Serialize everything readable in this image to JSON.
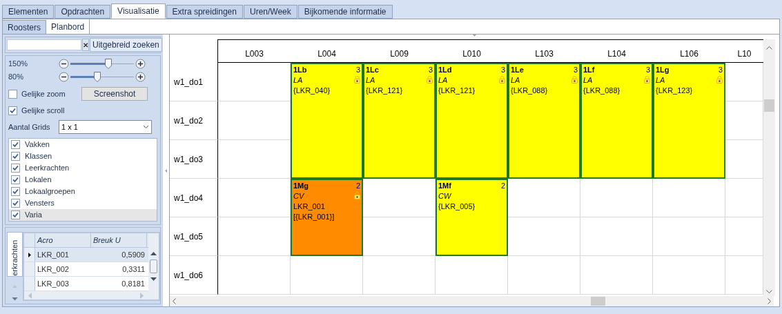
{
  "tabs": [
    {
      "label": "Elementen",
      "selected": false
    },
    {
      "label": "Opdrachten",
      "selected": false
    },
    {
      "label": "Visualisatie",
      "selected": true
    },
    {
      "label": "Extra spreidingen",
      "selected": false
    },
    {
      "label": "Uren/Week",
      "selected": false
    },
    {
      "label": "Bijkomende informatie",
      "selected": false
    }
  ],
  "subtabs": [
    {
      "label": "Roosters",
      "selected": false
    },
    {
      "label": "Planbord",
      "selected": true
    }
  ],
  "sidebar": {
    "clear_button": "✕",
    "advanced_search_button": "Uitgebreid zoeken",
    "zoom_sliders": [
      {
        "reading": "150%",
        "level": 0.6
      },
      {
        "reading": "80%",
        "level": 0.42
      }
    ],
    "equal_zoom": {
      "label": "Gelijke zoom",
      "checked": false
    },
    "screenshot_button": "Screenshot",
    "equal_scroll": {
      "label": "Gelijke scroll",
      "checked": true
    },
    "grid_count": {
      "label": "Aantal Grids",
      "value": "1 x 1"
    },
    "layers": [
      {
        "label": "Vakken",
        "checked": true,
        "selected": false
      },
      {
        "label": "Klassen",
        "checked": true,
        "selected": false
      },
      {
        "label": "Leerkrachten",
        "checked": true,
        "selected": false
      },
      {
        "label": "Lokalen",
        "checked": true,
        "selected": false
      },
      {
        "label": "Lokaalgroepen",
        "checked": true,
        "selected": false
      },
      {
        "label": "Vensters",
        "checked": true,
        "selected": false
      },
      {
        "label": "Varia",
        "checked": true,
        "selected": true
      }
    ],
    "side_tab": "erkrachten",
    "table": {
      "columns": [
        "Acro",
        "Breuk U"
      ],
      "rows": [
        {
          "cells": [
            "LKR_001",
            "0,5909"
          ],
          "selected": true
        },
        {
          "cells": [
            "LKR_002",
            "0,3311"
          ],
          "selected": false
        },
        {
          "cells": [
            "LKR_003",
            "0,8181"
          ],
          "selected": false
        }
      ]
    }
  },
  "planboard": {
    "columns": [
      "L003",
      "L004",
      "L009",
      "L010",
      "L103",
      "L104",
      "L106",
      "L10"
    ],
    "rows": [
      {
        "label": "w1_do1",
        "cells": [
          {
            "kind": "empty"
          },
          {
            "kind": "lesson",
            "code": "1Lb",
            "count": "3",
            "lines": [
              "LA",
              "{LKR_040}"
            ],
            "color": "#ffff00",
            "locked": true
          },
          {
            "kind": "lesson",
            "code": "1Lc",
            "count": "3",
            "lines": [
              "LA",
              "{LKR_121}"
            ],
            "color": "#ffff00",
            "locked": true
          },
          {
            "kind": "lesson",
            "code": "1Ld",
            "count": "3",
            "lines": [
              "LA",
              "{LKR_121}"
            ],
            "color": "#ffff00",
            "locked": true
          },
          {
            "kind": "lesson",
            "code": "1Le",
            "count": "3",
            "lines": [
              "LA",
              "{LKR_088}"
            ],
            "color": "#ffff00",
            "locked": true
          },
          {
            "kind": "lesson",
            "code": "1Lf",
            "count": "3",
            "lines": [
              "LA",
              "{LKR_088}"
            ],
            "color": "#ffff00",
            "locked": true
          },
          {
            "kind": "lesson",
            "code": "1Lg",
            "count": "3",
            "lines": [
              "LA",
              "{LKR_123}"
            ],
            "color": "#ffff00",
            "locked": true
          },
          {
            "kind": "empty"
          }
        ]
      },
      {
        "label": "w1_do2",
        "cells": [
          {
            "kind": "empty"
          },
          {
            "kind": "continued"
          },
          {
            "kind": "continued"
          },
          {
            "kind": "continued"
          },
          {
            "kind": "continued"
          },
          {
            "kind": "continued"
          },
          {
            "kind": "continued"
          },
          {
            "kind": "empty"
          }
        ]
      },
      {
        "label": "w1_do3",
        "cells": [
          {
            "kind": "empty"
          },
          {
            "kind": "continued"
          },
          {
            "kind": "continued"
          },
          {
            "kind": "continued"
          },
          {
            "kind": "continued"
          },
          {
            "kind": "continued"
          },
          {
            "kind": "continued"
          },
          {
            "kind": "empty"
          }
        ]
      },
      {
        "label": "w1_do4",
        "cells": [
          {
            "kind": "empty"
          },
          {
            "kind": "lesson",
            "code": "1Mg",
            "count": "2",
            "lines": [
              "CV",
              "LKR_001",
              "[{LKR_001}]"
            ],
            "color": "#ff8c00",
            "locked": true
          },
          {
            "kind": "empty"
          },
          {
            "kind": "lesson",
            "code": "1Mf",
            "count": "2",
            "lines": [
              "CW",
              "{LKR_005}"
            ],
            "color": "#ffff00",
            "locked": false
          },
          {
            "kind": "empty"
          },
          {
            "kind": "empty"
          },
          {
            "kind": "empty"
          },
          {
            "kind": "empty"
          }
        ]
      },
      {
        "label": "w1_do5",
        "cells": [
          {
            "kind": "empty"
          },
          {
            "kind": "continued"
          },
          {
            "kind": "empty"
          },
          {
            "kind": "continued"
          },
          {
            "kind": "empty"
          },
          {
            "kind": "empty"
          },
          {
            "kind": "empty"
          },
          {
            "kind": "empty"
          }
        ]
      },
      {
        "label": "w1_do6",
        "cells": [
          {
            "kind": "empty"
          },
          {
            "kind": "empty"
          },
          {
            "kind": "empty"
          },
          {
            "kind": "empty"
          },
          {
            "kind": "empty"
          },
          {
            "kind": "empty"
          },
          {
            "kind": "empty"
          },
          {
            "kind": "empty"
          }
        ]
      }
    ]
  }
}
